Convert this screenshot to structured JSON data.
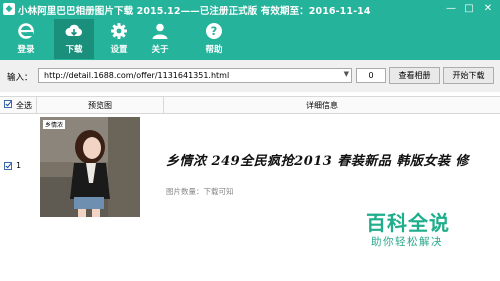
{
  "window": {
    "title": "小林阿里巴巴相册图片下载 2015.12——已注册正式版 有效期至：2016-11-14",
    "icon": "app-logo-icon"
  },
  "toolbar": {
    "items": [
      {
        "label": "登录",
        "icon": "ie-icon"
      },
      {
        "label": "下载",
        "icon": "cloud-download-icon"
      },
      {
        "label": "设置",
        "icon": "gear-icon"
      },
      {
        "label": "关于",
        "icon": "user-icon"
      },
      {
        "label": "帮助",
        "icon": "help-icon"
      }
    ],
    "active_index": 1
  },
  "input_row": {
    "label": "输入：",
    "url": "http://detail.1688.com/offer/1131641351.html",
    "count": "0",
    "view_album_button": "查看相册",
    "start_download_button": "开始下载"
  },
  "table": {
    "columns": [
      "全选",
      "预览图",
      "详细信息"
    ],
    "rows": [
      {
        "index": "1",
        "checked": true,
        "thumb_label": "乡情浓",
        "title": "乡情浓 249全民疯抢2013 春装新品 韩版女装 修",
        "image_count": "图片数量：下载可知"
      }
    ]
  },
  "watermark": {
    "main": "百科全说",
    "sub": "助你轻松解决"
  },
  "colors": {
    "header": "#26b39b",
    "header_active": "#1a8f7c",
    "watermark": "#1fae8b"
  }
}
